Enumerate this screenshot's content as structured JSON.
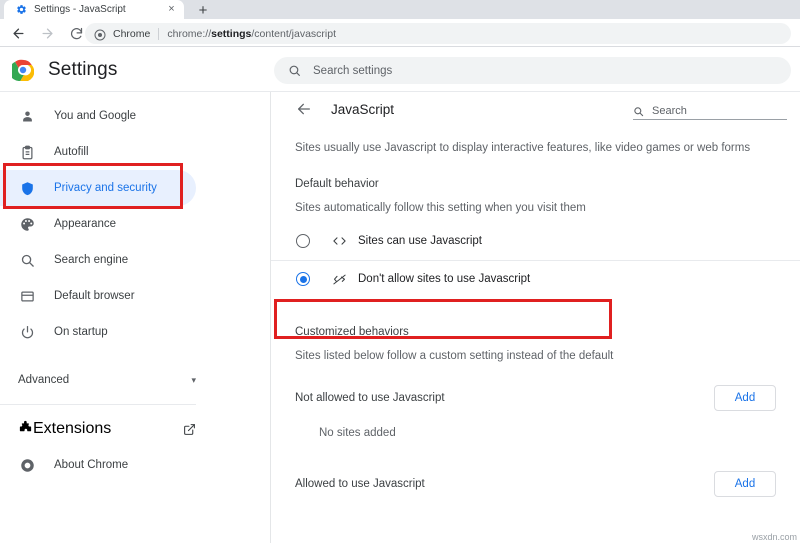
{
  "browser": {
    "tab": {
      "title": "Settings - JavaScript",
      "favicon": "gear-icon",
      "close_label": "×"
    },
    "new_tab_label": "+",
    "nav": {
      "back_label": "←",
      "forward_label": "→",
      "reload_label": "⟳"
    },
    "omnibox": {
      "scheme_label": "Chrome",
      "url_prefix": "chrome://",
      "url_bold": "settings",
      "url_suffix": "/content/javascript"
    }
  },
  "settings_header": {
    "title": "Settings",
    "search": {
      "placeholder": "Search settings",
      "value": ""
    }
  },
  "sidebar": {
    "items": [
      {
        "label": "You and Google",
        "icon": "person-icon",
        "selected": false
      },
      {
        "label": "Autofill",
        "icon": "clipboard-icon",
        "selected": false
      },
      {
        "label": "Privacy and security",
        "icon": "shield-icon",
        "selected": true
      },
      {
        "label": "Appearance",
        "icon": "palette-icon",
        "selected": false
      },
      {
        "label": "Search engine",
        "icon": "search-icon",
        "selected": false
      },
      {
        "label": "Default browser",
        "icon": "browser-window-icon",
        "selected": false
      },
      {
        "label": "On startup",
        "icon": "power-icon",
        "selected": false
      }
    ],
    "advanced": {
      "label": "Advanced",
      "caret": "▾"
    },
    "footer_items": [
      {
        "label": "Extensions",
        "icon": "puzzle-icon",
        "external": true
      },
      {
        "label": "About Chrome",
        "icon": "chrome-icon",
        "external": false
      }
    ]
  },
  "content": {
    "back_label": "←",
    "title": "JavaScript",
    "search": {
      "placeholder": "Search",
      "value": ""
    },
    "description": "Sites usually use Javascript to display interactive features, like video games or web forms",
    "default_behavior": {
      "heading": "Default behavior",
      "subtitle": "Sites automatically follow this setting when you visit them",
      "options": [
        {
          "label": "Sites can use Javascript",
          "icon": "code-brackets-icon",
          "selected": false
        },
        {
          "label": "Don't allow sites to use Javascript",
          "icon": "code-brackets-slash-icon",
          "selected": true
        }
      ]
    },
    "customized_behaviors": {
      "heading": "Customized behaviors",
      "subtitle": "Sites listed below follow a custom setting instead of the default",
      "groups": [
        {
          "label": "Not allowed to use Javascript",
          "add_label": "Add",
          "empty_text": "No sites added"
        },
        {
          "label": "Allowed to use Javascript",
          "add_label": "Add",
          "empty_text": ""
        }
      ]
    }
  },
  "annotations": {
    "highlight_color": "#e02020",
    "boxes": [
      {
        "target": "sidebar-item-privacy-and-security"
      },
      {
        "target": "radio-dont-allow-javascript"
      }
    ]
  },
  "watermark": "wsxdn.com",
  "colors": {
    "accent": "#1a73e8",
    "selected_bg": "#e8f0fe",
    "text_primary": "#202124",
    "text_secondary": "#5f6368",
    "tabstrip_bg": "#dee1e6",
    "omnibox_bg": "#f1f3f4"
  }
}
